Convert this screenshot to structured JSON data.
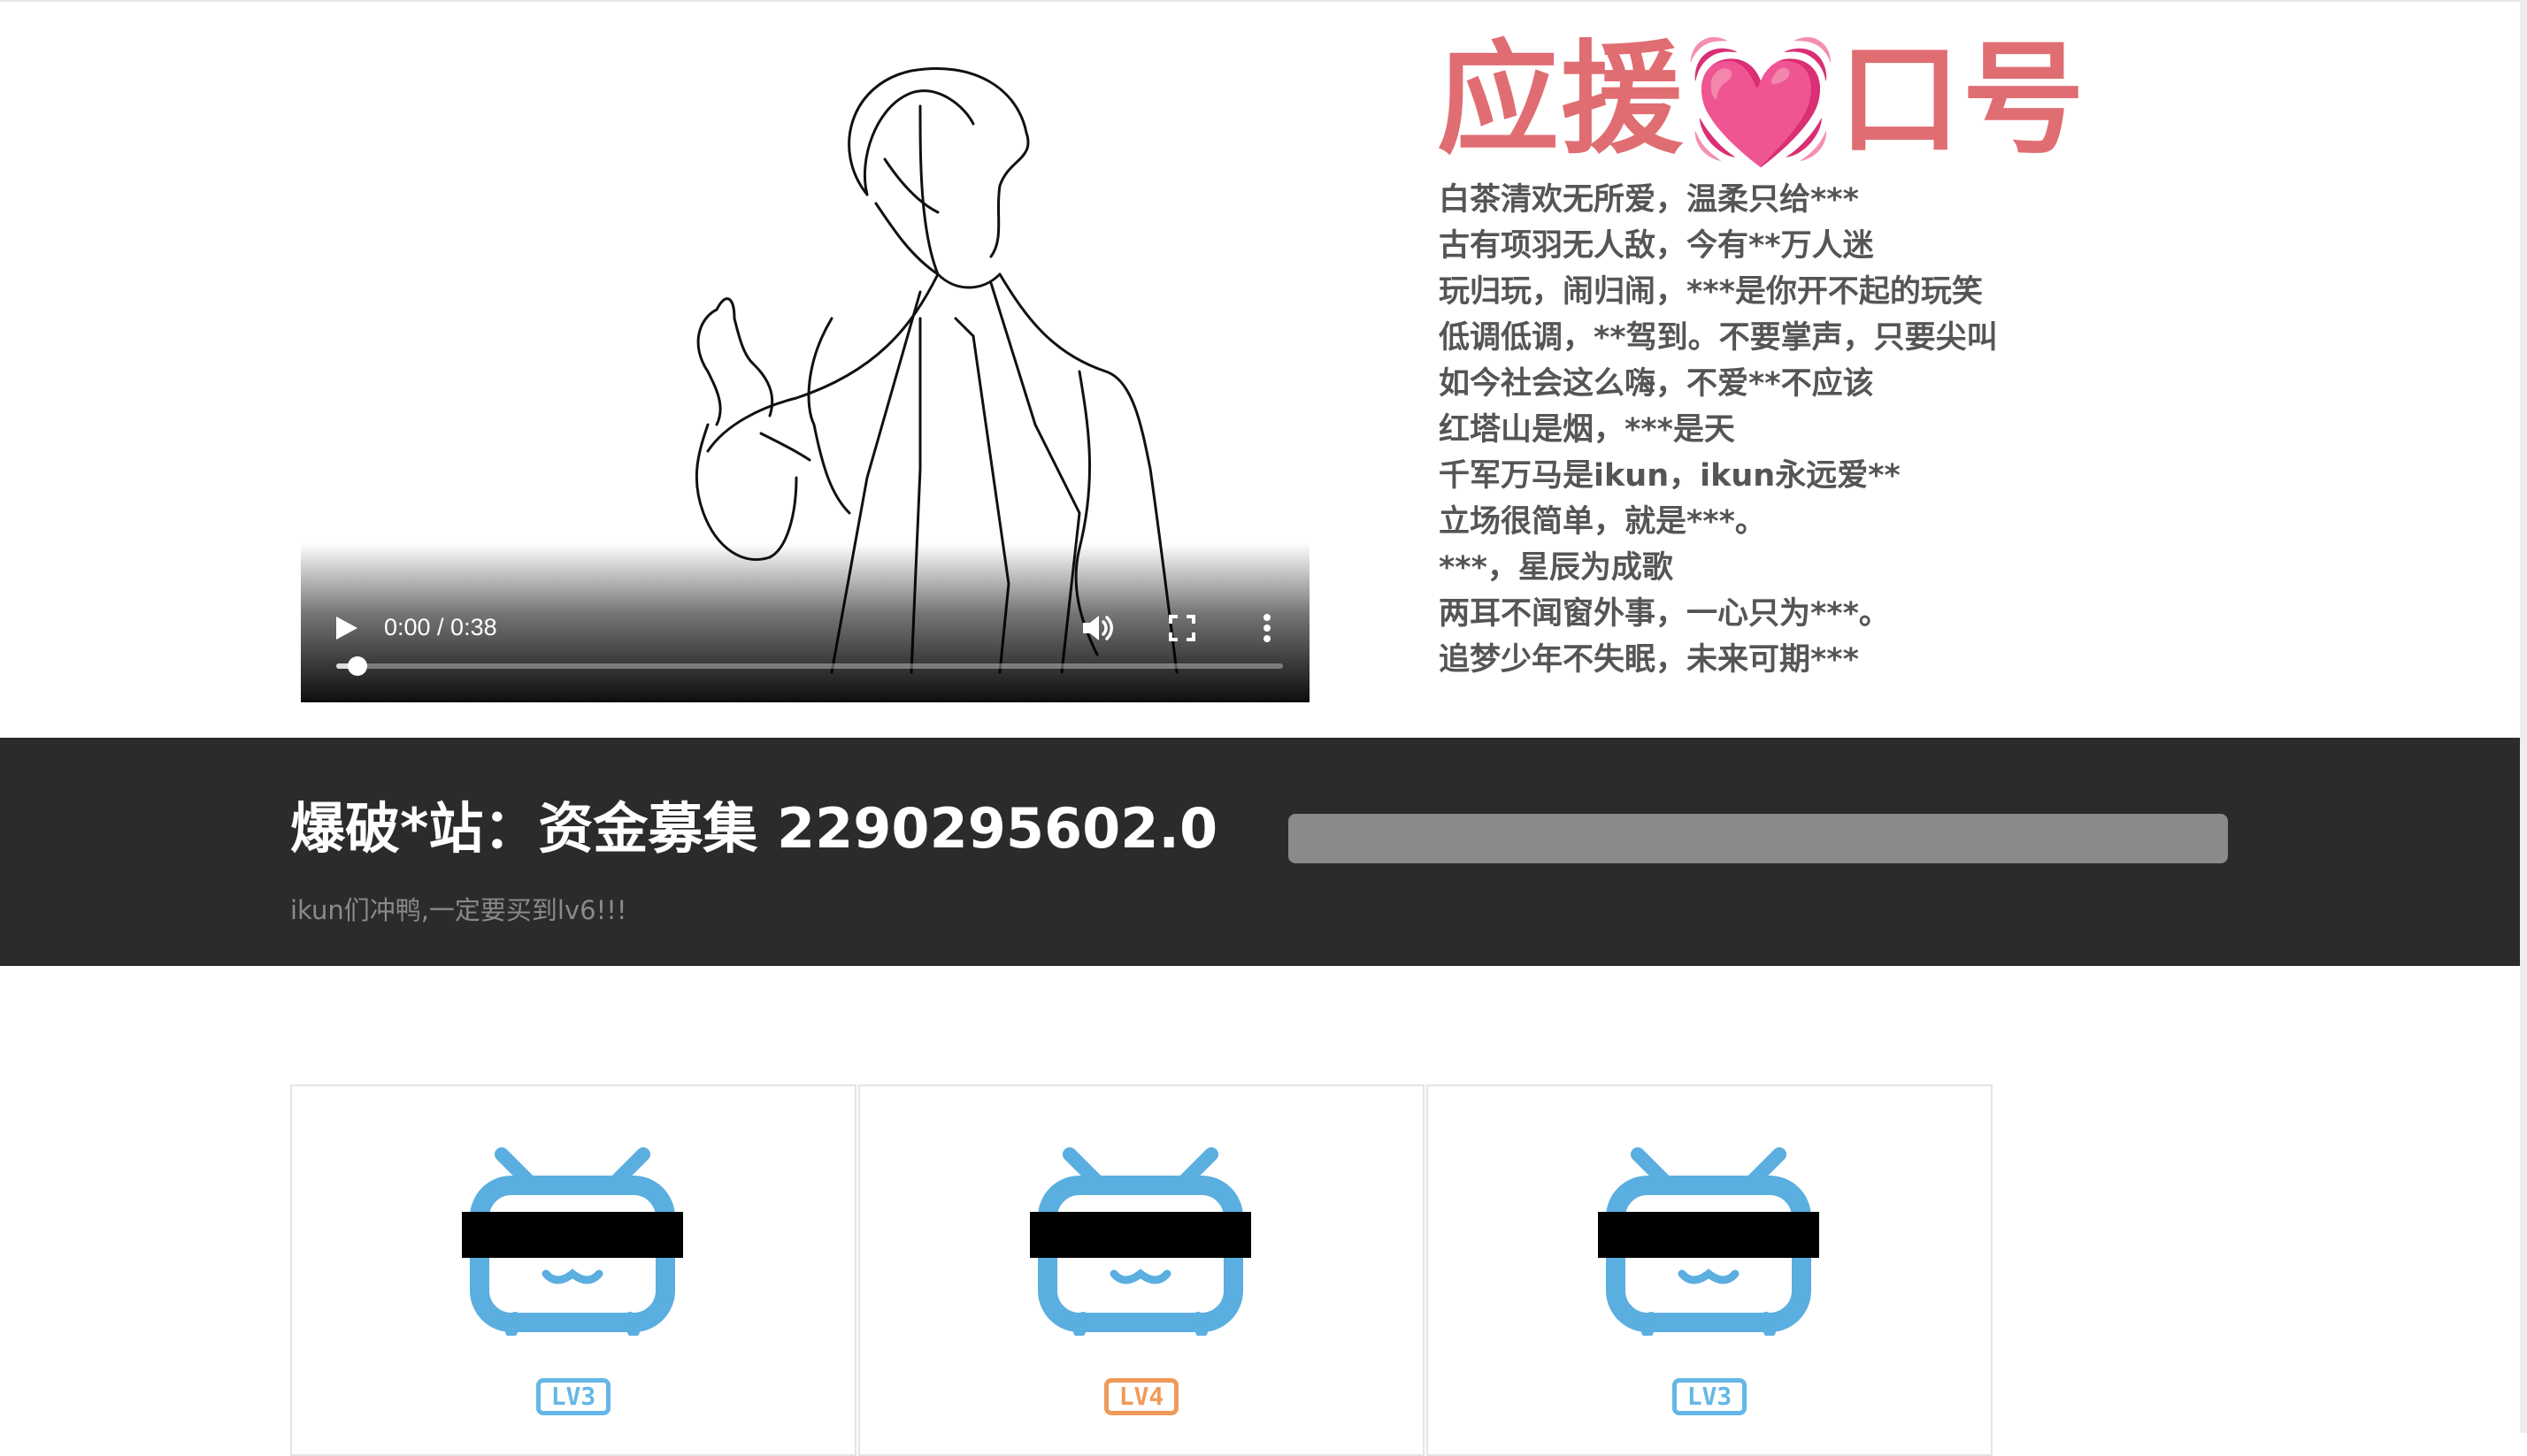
{
  "video": {
    "time": "0:00 / 0:38",
    "progress_fraction": 0.02,
    "icons": [
      "play-icon",
      "volume-icon",
      "fullscreen-icon",
      "more-vert-icon"
    ]
  },
  "slogans": {
    "title": "应援💓口号",
    "lines": [
      "白茶清欢无所爱，温柔只给***",
      "古有项羽无人敌，今有**万人迷",
      "玩归玩，闹归闹，***是你开不起的玩笑",
      "低调低调，**驾到。不要掌声，只要尖叫",
      "如今社会这么嗨，不爱**不应该",
      "红塔山是烟，***是天",
      "千军万马是ikun，ikun永远爱**",
      "立场很简单，就是***。",
      "***，星辰为成歌",
      "两耳不闻窗外事，一心只为***。",
      "追梦少年不失眠，未来可期***"
    ]
  },
  "funding": {
    "title": "爆破*站：资金募集 2290295602.0",
    "subtitle": "ikun们冲鸭,一定要买到lv6!!!",
    "progress_fraction": 1.0
  },
  "cards": [
    {
      "level": "LV3",
      "color": "#64b7e6"
    },
    {
      "level": "LV4",
      "color": "#f09a5a"
    },
    {
      "level": "LV3",
      "color": "#64b7e6"
    }
  ],
  "colors": {
    "accent_pink": "#e06d72",
    "tv_blue": "#5aaee0",
    "banner_bg": "#2b2b2b"
  }
}
